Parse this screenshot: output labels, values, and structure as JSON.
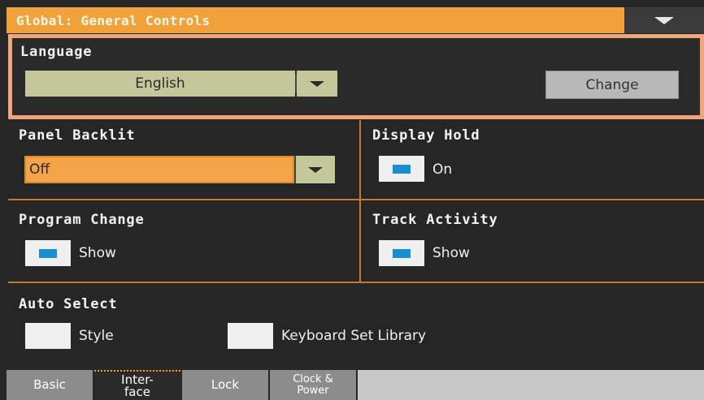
{
  "header": {
    "title": "Global: General Controls",
    "menu_icon": "triangle-down-icon"
  },
  "language": {
    "label": "Language",
    "value": "English",
    "change_label": "Change"
  },
  "panel_backlit": {
    "label": "Panel Backlit",
    "value": "Off"
  },
  "display_hold": {
    "label": "Display Hold",
    "checkbox_label": "On",
    "checked": true
  },
  "program_change": {
    "label": "Program Change",
    "checkbox_label": "Show",
    "checked": true
  },
  "track_activity": {
    "label": "Track Activity",
    "checkbox_label": "Show",
    "checked": true
  },
  "auto_select": {
    "label": "Auto Select",
    "style_label": "Style",
    "style_checked": false,
    "keyboard_set_label": "Keyboard Set Library",
    "keyboard_set_checked": false
  },
  "tabs": [
    {
      "line1": "Basic",
      "line2": ""
    },
    {
      "line1": "Inter-",
      "line2": "face"
    },
    {
      "line1": "Lock",
      "line2": ""
    },
    {
      "line1": "Clock &",
      "line2": "Power"
    }
  ],
  "colors": {
    "accent": "#f2a23a",
    "highlight": "#f1a57b",
    "check": "#1a8fd0",
    "background": "#262626"
  }
}
